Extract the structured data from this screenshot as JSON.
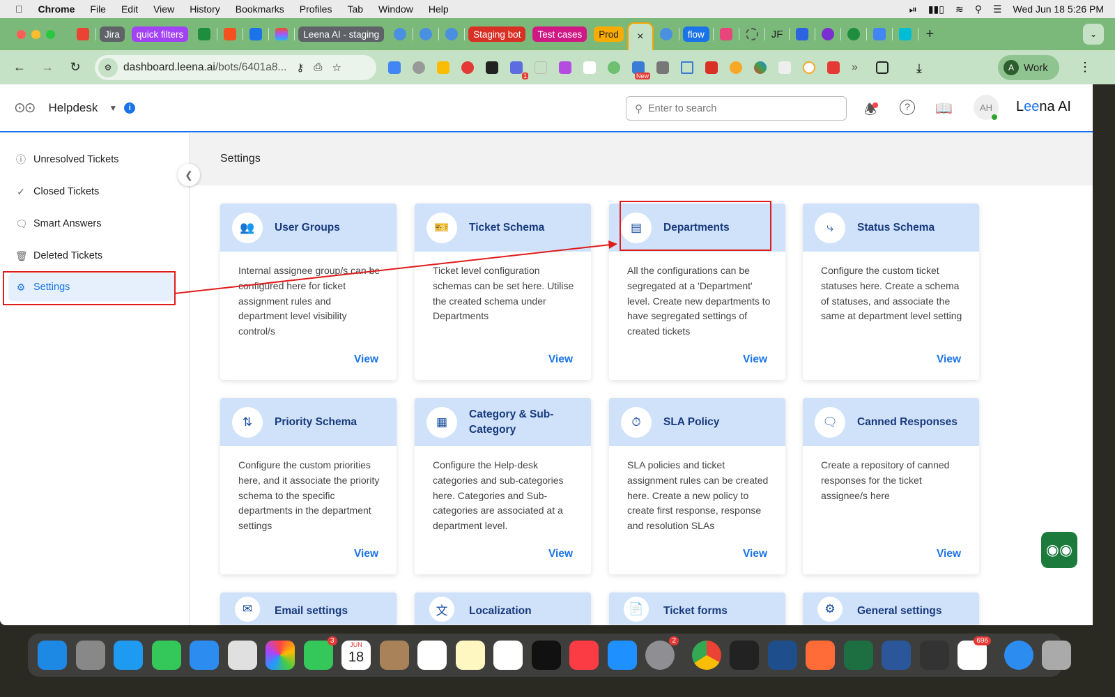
{
  "menubar": {
    "app": "Chrome",
    "items": [
      "File",
      "Edit",
      "View",
      "History",
      "Bookmarks",
      "Profiles",
      "Tab",
      "Window",
      "Help"
    ],
    "clock": "Wed Jun 18  5:26 PM"
  },
  "tabs": {
    "labeled": [
      {
        "label": "Jira",
        "color": "#5f6368"
      },
      {
        "label": "quick filters",
        "color": "#a142f4"
      },
      {
        "label": "Leena AI - staging",
        "color": "#5f6368"
      },
      {
        "label": "Staging bot",
        "color": "#d93025"
      },
      {
        "label": "Test cases",
        "color": "#d01884"
      },
      {
        "label": "Prod",
        "color": "#f9ab00"
      },
      {
        "label": "flow",
        "color": "#1a73e8"
      }
    ],
    "active_close": "×",
    "jf": "JF",
    "new_tab": "+"
  },
  "toolbar": {
    "url_host": "dashboard.leena.ai",
    "url_path": "/bots/6401a8...",
    "ext_badge": "1",
    "ext_new": "New",
    "profile_initial": "A",
    "profile_label": "Work"
  },
  "header": {
    "title": "Helpdesk",
    "search_placeholder": "Enter to search",
    "avatar": "AH",
    "logo_a": "L",
    "logo_b": "ee",
    "logo_c": "na AI"
  },
  "sidebar": {
    "items": [
      {
        "label": "Unresolved Tickets",
        "icon": "info-icon"
      },
      {
        "label": "Closed Tickets",
        "icon": "check-circle-icon"
      },
      {
        "label": "Smart Answers",
        "icon": "chat-icon"
      },
      {
        "label": "Deleted Tickets",
        "icon": "trash-icon"
      },
      {
        "label": "Settings",
        "icon": "gear-icon",
        "active": true
      }
    ]
  },
  "main": {
    "title": "Settings",
    "view_label": "View",
    "cards": [
      {
        "title": "User Groups",
        "icon": "users-icon",
        "desc": "Internal assignee group/s can be configured here for ticket assignment rules and department level visibility control/s"
      },
      {
        "title": "Ticket Schema",
        "icon": "ticket-icon",
        "desc": "Ticket level configuration schemas can be set here. Utilise the created schema under Departments"
      },
      {
        "title": "Departments",
        "icon": "building-icon",
        "desc": "All the configurations can be segregated at a 'Department' level. Create new departments to have segregated settings of created tickets"
      },
      {
        "title": "Status Schema",
        "icon": "flow-icon",
        "desc": "Configure the custom ticket statuses here. Create a schema of statuses, and associate the same at department level setting"
      },
      {
        "title": "Priority Schema",
        "icon": "priority-icon",
        "desc": "Configure the custom priorities here, and it associate the priority schema to the specific departments in the department settings"
      },
      {
        "title": "Category & Sub-Category",
        "icon": "category-icon",
        "desc": "Configure the Help-desk categories and sub-categories here. Categories and Sub-categories are associated at a department level."
      },
      {
        "title": "SLA Policy",
        "icon": "timer-icon",
        "desc": "SLA policies and ticket assignment rules can be created here. Create a new policy to create first response, response and resolution SLAs"
      },
      {
        "title": "Canned Responses",
        "icon": "canned-icon",
        "desc": "Create a repository of canned responses for the ticket assignee/s here"
      },
      {
        "title": "Email settings",
        "icon": "email-icon",
        "desc": ""
      },
      {
        "title": "Localization",
        "icon": "translate-icon",
        "desc": ""
      },
      {
        "title": "Ticket forms",
        "icon": "form-icon",
        "desc": ""
      },
      {
        "title": "General settings",
        "icon": "gear-icon",
        "desc": ""
      }
    ]
  },
  "dock": {
    "calendar_month": "JUN",
    "calendar_day": "18",
    "badges": {
      "facetime": "3",
      "settings": "2",
      "slack": "696"
    }
  },
  "colors": {
    "accent": "#1a73e8",
    "card_header": "#cfe2fa",
    "annotation": "#e01b1b",
    "tab_strip": "#7bb97b"
  }
}
